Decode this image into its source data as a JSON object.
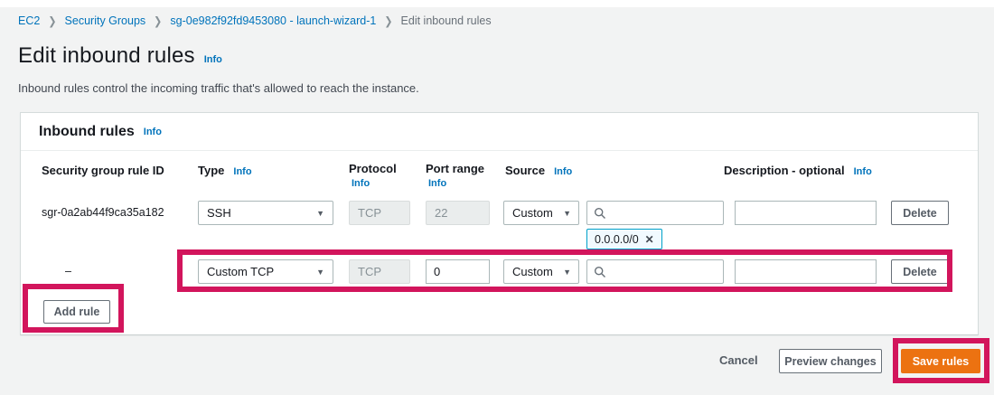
{
  "breadcrumb": {
    "items": [
      "EC2",
      "Security Groups",
      "sg-0e982f92fd9453080 - launch-wizard-1",
      "Edit inbound rules"
    ]
  },
  "page": {
    "title": "Edit inbound rules",
    "info_label": "Info",
    "subtitle": "Inbound rules control the incoming traffic that's allowed to reach the instance."
  },
  "panel": {
    "title": "Inbound rules",
    "info_label": "Info"
  },
  "table": {
    "headers": {
      "rule_id": "Security group rule ID",
      "type": "Type",
      "protocol": "Protocol",
      "port_range": "Port range",
      "source": "Source",
      "description": "Description - optional",
      "info_label": "Info"
    }
  },
  "rules": [
    {
      "rule_id": "sgr-0a2ab44f9ca35a182",
      "type": "SSH",
      "protocol": "TCP",
      "port_range": "22",
      "source_mode": "Custom",
      "source_token": "0.0.0.0/0",
      "description": "",
      "delete_label": "Delete"
    },
    {
      "rule_id": "–",
      "type": "Custom TCP",
      "protocol": "TCP",
      "port_range": "0",
      "source_mode": "Custom",
      "source_token": "",
      "description": "",
      "delete_label": "Delete"
    }
  ],
  "buttons": {
    "add_rule": "Add rule",
    "cancel": "Cancel",
    "preview": "Preview changes",
    "save": "Save rules"
  },
  "icons": {
    "breadcrumb_separator": "❯",
    "caret": "▼",
    "dismiss": "✕",
    "search": "magnifier"
  },
  "colors": {
    "link_blue": "#0073bb",
    "accent_orange": "#ec7211",
    "annotation_red": "#d2155c",
    "disabled_bg": "#eaeded"
  }
}
